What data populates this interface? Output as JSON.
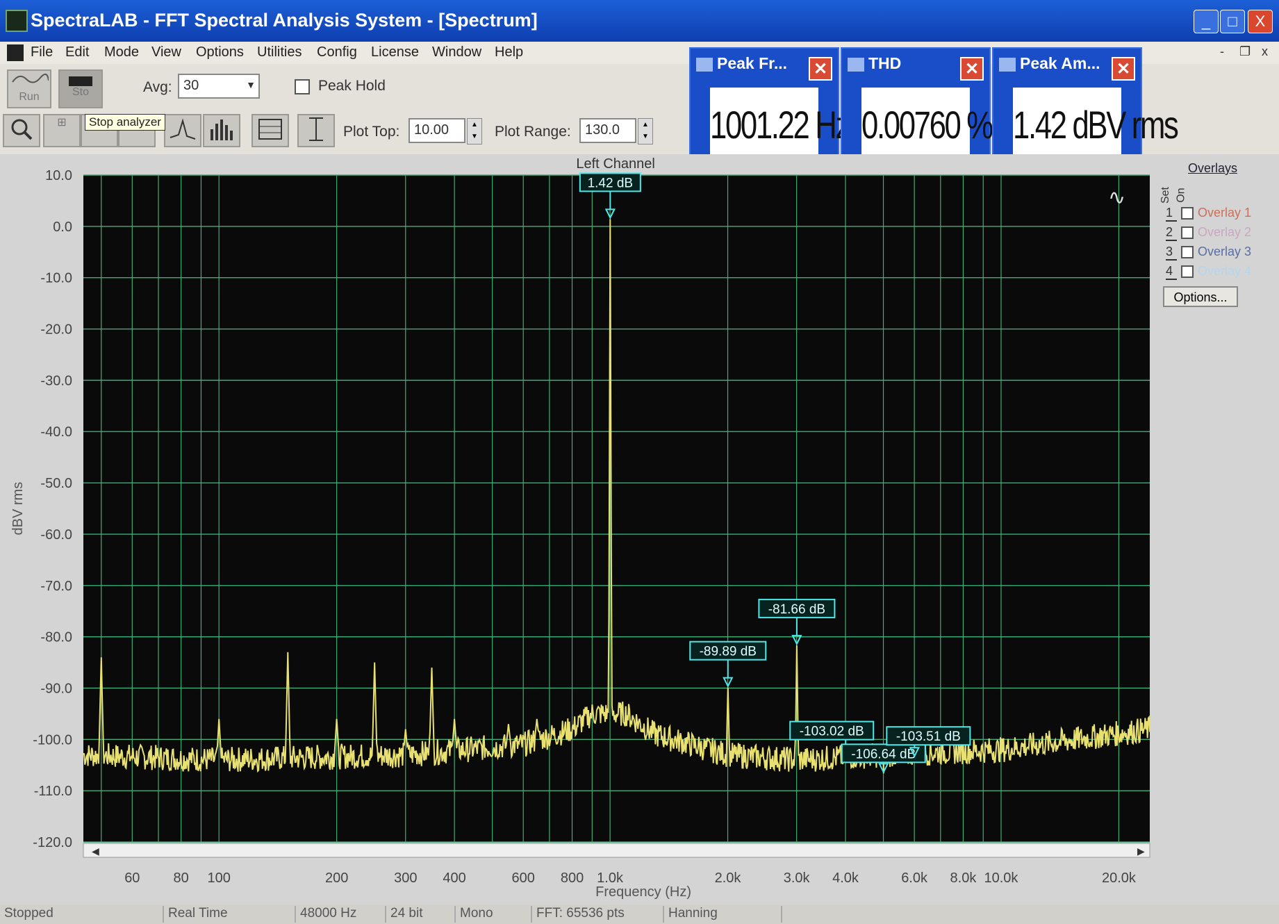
{
  "window": {
    "title": "SpectraLAB - FFT Spectral Analysis System - [Spectrum]",
    "controls": [
      "_",
      "□",
      "X"
    ]
  },
  "menu": {
    "items": [
      "File",
      "Edit",
      "Mode",
      "View",
      "Options",
      "Utilities",
      "Config",
      "License",
      "Window",
      "Help"
    ],
    "mdi_controls": [
      "-",
      "❐",
      "x"
    ]
  },
  "toolbar": {
    "run_label": "Run",
    "stop_label": "Sto",
    "avg_label": "Avg:",
    "avg_value": "30",
    "peak_hold_label": "Peak Hold",
    "tooltip": "Stop analyzer",
    "plot_top_label": "Plot Top:",
    "plot_top_value": "10.00",
    "plot_range_label": "Plot Range:",
    "plot_range_value": "130.0",
    "icons": [
      "zoom-icon",
      "zoom-2x-icon",
      "zoom-out-icon",
      "peak-icon",
      "line-plot-icon",
      "bar-plot-icon",
      "table-icon",
      "cursor-icon"
    ]
  },
  "readouts": [
    {
      "title": "Peak Fr...",
      "value": "1001.22 Hz"
    },
    {
      "title": "THD",
      "value": "0.00760 %"
    },
    {
      "title": "Peak Am...",
      "value": "1.42 dBV rms"
    }
  ],
  "overlays": {
    "title": "Overlays",
    "head_set": "Set",
    "head_on": "On",
    "items": [
      {
        "num": "1",
        "label": "Overlay 1",
        "color": "#c9705a"
      },
      {
        "num": "2",
        "label": "Overlay 2",
        "color": "#c8a8c0"
      },
      {
        "num": "3",
        "label": "Overlay 3",
        "color": "#5a6ea0"
      },
      {
        "num": "4",
        "label": "Overlay 4",
        "color": "#b8d4ec"
      }
    ],
    "options_label": "Options..."
  },
  "statusbar": [
    "Stopped",
    "Real Time",
    "48000 Hz",
    "24 bit",
    "Mono",
    "FFT: 65536 pts",
    "Hanning"
  ],
  "colors": {
    "plot_bg": "#0a0a0a",
    "grid": "#3fae78",
    "trace": "#e8e070",
    "marker": "#4fe8e8",
    "title_bar": "#1a4ec8"
  },
  "chart_data": {
    "type": "line",
    "title": "Left Channel",
    "xlabel": "Frequency (Hz)",
    "ylabel": "dBV rms",
    "x_scale": "log",
    "xlim": [
      45,
      24000
    ],
    "ylim": [
      -120,
      10
    ],
    "y_ticks": [
      "10.0",
      "0.0",
      "-10.0",
      "-20.0",
      "-30.0",
      "-40.0",
      "-50.0",
      "-60.0",
      "-70.0",
      "-80.0",
      "-90.0",
      "-100.0",
      "-110.0",
      "-120.0"
    ],
    "x_ticks": [
      {
        "v": 60,
        "label": "60"
      },
      {
        "v": 80,
        "label": "80"
      },
      {
        "v": 100,
        "label": "100"
      },
      {
        "v": 200,
        "label": "200"
      },
      {
        "v": 300,
        "label": "300"
      },
      {
        "v": 400,
        "label": "400"
      },
      {
        "v": 600,
        "label": "600"
      },
      {
        "v": 800,
        "label": "800"
      },
      {
        "v": 1000,
        "label": "1.0k"
      },
      {
        "v": 2000,
        "label": "2.0k"
      },
      {
        "v": 3000,
        "label": "3.0k"
      },
      {
        "v": 4000,
        "label": "4.0k"
      },
      {
        "v": 6000,
        "label": "6.0k"
      },
      {
        "v": 8000,
        "label": "8.0k"
      },
      {
        "v": 10000,
        "label": "10.0k"
      },
      {
        "v": 20000,
        "label": "20.0k"
      }
    ],
    "grid": true,
    "noise_floor": [
      [
        45,
        -103
      ],
      [
        100,
        -104
      ],
      [
        300,
        -103
      ],
      [
        600,
        -101
      ],
      [
        800,
        -98
      ],
      [
        900,
        -95
      ],
      [
        1100,
        -95
      ],
      [
        1300,
        -99
      ],
      [
        2000,
        -103
      ],
      [
        3000,
        -104
      ],
      [
        5000,
        -103
      ],
      [
        10000,
        -102
      ],
      [
        24000,
        -98
      ]
    ],
    "peaks": [
      {
        "x": 50,
        "y": -84
      },
      {
        "x": 100,
        "y": -96
      },
      {
        "x": 150,
        "y": -83
      },
      {
        "x": 200,
        "y": -96
      },
      {
        "x": 250,
        "y": -85
      },
      {
        "x": 300,
        "y": -98
      },
      {
        "x": 350,
        "y": -86
      },
      {
        "x": 400,
        "y": -96
      },
      {
        "x": 550,
        "y": -97
      },
      {
        "x": 650,
        "y": -96
      },
      {
        "x": 1001,
        "y": 1.42
      },
      {
        "x": 2002,
        "y": -89.89
      },
      {
        "x": 3003,
        "y": -81.66
      },
      {
        "x": 4004,
        "y": -103.02
      },
      {
        "x": 5005,
        "y": -106.64
      },
      {
        "x": 6006,
        "y": -103.51
      }
    ],
    "markers": [
      {
        "x": 1001,
        "y": 1.42,
        "label": "1.42 dB"
      },
      {
        "x": 2002,
        "y": -89.89,
        "label": "-89.89 dB"
      },
      {
        "x": 3003,
        "y": -81.66,
        "label": "-81.66 dB"
      },
      {
        "x": 4004,
        "y": -103.02,
        "label": "-103.02 dB"
      },
      {
        "x": 5005,
        "y": -106.64,
        "label": "-106.64 dB"
      },
      {
        "x": 6006,
        "y": -103.51,
        "label": "-103.51 dB"
      }
    ]
  }
}
